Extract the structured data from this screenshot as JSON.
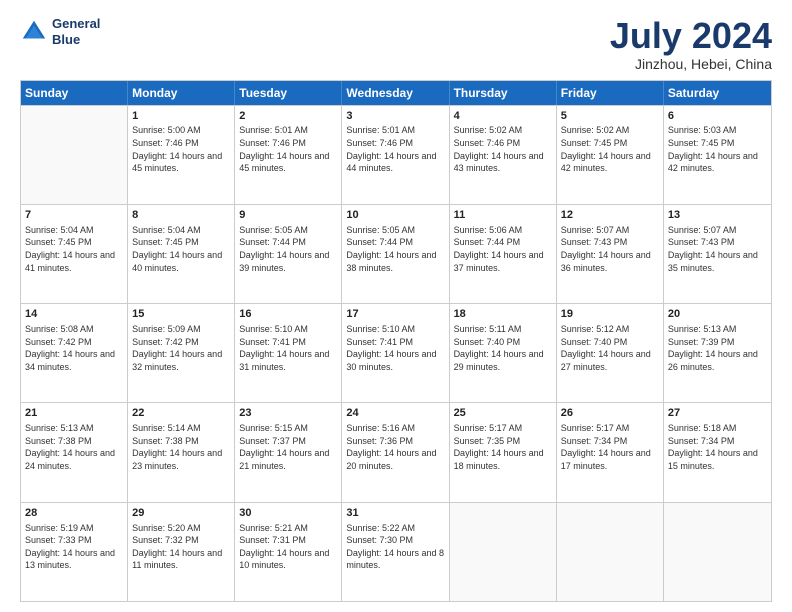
{
  "logo": {
    "line1": "General",
    "line2": "Blue"
  },
  "title": "July 2024",
  "subtitle": "Jinzhou, Hebei, China",
  "header_days": [
    "Sunday",
    "Monday",
    "Tuesday",
    "Wednesday",
    "Thursday",
    "Friday",
    "Saturday"
  ],
  "weeks": [
    [
      {
        "day": "",
        "sunrise": "",
        "sunset": "",
        "daylight": ""
      },
      {
        "day": "1",
        "sunrise": "Sunrise: 5:00 AM",
        "sunset": "Sunset: 7:46 PM",
        "daylight": "Daylight: 14 hours and 45 minutes."
      },
      {
        "day": "2",
        "sunrise": "Sunrise: 5:01 AM",
        "sunset": "Sunset: 7:46 PM",
        "daylight": "Daylight: 14 hours and 45 minutes."
      },
      {
        "day": "3",
        "sunrise": "Sunrise: 5:01 AM",
        "sunset": "Sunset: 7:46 PM",
        "daylight": "Daylight: 14 hours and 44 minutes."
      },
      {
        "day": "4",
        "sunrise": "Sunrise: 5:02 AM",
        "sunset": "Sunset: 7:46 PM",
        "daylight": "Daylight: 14 hours and 43 minutes."
      },
      {
        "day": "5",
        "sunrise": "Sunrise: 5:02 AM",
        "sunset": "Sunset: 7:45 PM",
        "daylight": "Daylight: 14 hours and 42 minutes."
      },
      {
        "day": "6",
        "sunrise": "Sunrise: 5:03 AM",
        "sunset": "Sunset: 7:45 PM",
        "daylight": "Daylight: 14 hours and 42 minutes."
      }
    ],
    [
      {
        "day": "7",
        "sunrise": "Sunrise: 5:04 AM",
        "sunset": "Sunset: 7:45 PM",
        "daylight": "Daylight: 14 hours and 41 minutes."
      },
      {
        "day": "8",
        "sunrise": "Sunrise: 5:04 AM",
        "sunset": "Sunset: 7:45 PM",
        "daylight": "Daylight: 14 hours and 40 minutes."
      },
      {
        "day": "9",
        "sunrise": "Sunrise: 5:05 AM",
        "sunset": "Sunset: 7:44 PM",
        "daylight": "Daylight: 14 hours and 39 minutes."
      },
      {
        "day": "10",
        "sunrise": "Sunrise: 5:05 AM",
        "sunset": "Sunset: 7:44 PM",
        "daylight": "Daylight: 14 hours and 38 minutes."
      },
      {
        "day": "11",
        "sunrise": "Sunrise: 5:06 AM",
        "sunset": "Sunset: 7:44 PM",
        "daylight": "Daylight: 14 hours and 37 minutes."
      },
      {
        "day": "12",
        "sunrise": "Sunrise: 5:07 AM",
        "sunset": "Sunset: 7:43 PM",
        "daylight": "Daylight: 14 hours and 36 minutes."
      },
      {
        "day": "13",
        "sunrise": "Sunrise: 5:07 AM",
        "sunset": "Sunset: 7:43 PM",
        "daylight": "Daylight: 14 hours and 35 minutes."
      }
    ],
    [
      {
        "day": "14",
        "sunrise": "Sunrise: 5:08 AM",
        "sunset": "Sunset: 7:42 PM",
        "daylight": "Daylight: 14 hours and 34 minutes."
      },
      {
        "day": "15",
        "sunrise": "Sunrise: 5:09 AM",
        "sunset": "Sunset: 7:42 PM",
        "daylight": "Daylight: 14 hours and 32 minutes."
      },
      {
        "day": "16",
        "sunrise": "Sunrise: 5:10 AM",
        "sunset": "Sunset: 7:41 PM",
        "daylight": "Daylight: 14 hours and 31 minutes."
      },
      {
        "day": "17",
        "sunrise": "Sunrise: 5:10 AM",
        "sunset": "Sunset: 7:41 PM",
        "daylight": "Daylight: 14 hours and 30 minutes."
      },
      {
        "day": "18",
        "sunrise": "Sunrise: 5:11 AM",
        "sunset": "Sunset: 7:40 PM",
        "daylight": "Daylight: 14 hours and 29 minutes."
      },
      {
        "day": "19",
        "sunrise": "Sunrise: 5:12 AM",
        "sunset": "Sunset: 7:40 PM",
        "daylight": "Daylight: 14 hours and 27 minutes."
      },
      {
        "day": "20",
        "sunrise": "Sunrise: 5:13 AM",
        "sunset": "Sunset: 7:39 PM",
        "daylight": "Daylight: 14 hours and 26 minutes."
      }
    ],
    [
      {
        "day": "21",
        "sunrise": "Sunrise: 5:13 AM",
        "sunset": "Sunset: 7:38 PM",
        "daylight": "Daylight: 14 hours and 24 minutes."
      },
      {
        "day": "22",
        "sunrise": "Sunrise: 5:14 AM",
        "sunset": "Sunset: 7:38 PM",
        "daylight": "Daylight: 14 hours and 23 minutes."
      },
      {
        "day": "23",
        "sunrise": "Sunrise: 5:15 AM",
        "sunset": "Sunset: 7:37 PM",
        "daylight": "Daylight: 14 hours and 21 minutes."
      },
      {
        "day": "24",
        "sunrise": "Sunrise: 5:16 AM",
        "sunset": "Sunset: 7:36 PM",
        "daylight": "Daylight: 14 hours and 20 minutes."
      },
      {
        "day": "25",
        "sunrise": "Sunrise: 5:17 AM",
        "sunset": "Sunset: 7:35 PM",
        "daylight": "Daylight: 14 hours and 18 minutes."
      },
      {
        "day": "26",
        "sunrise": "Sunrise: 5:17 AM",
        "sunset": "Sunset: 7:34 PM",
        "daylight": "Daylight: 14 hours and 17 minutes."
      },
      {
        "day": "27",
        "sunrise": "Sunrise: 5:18 AM",
        "sunset": "Sunset: 7:34 PM",
        "daylight": "Daylight: 14 hours and 15 minutes."
      }
    ],
    [
      {
        "day": "28",
        "sunrise": "Sunrise: 5:19 AM",
        "sunset": "Sunset: 7:33 PM",
        "daylight": "Daylight: 14 hours and 13 minutes."
      },
      {
        "day": "29",
        "sunrise": "Sunrise: 5:20 AM",
        "sunset": "Sunset: 7:32 PM",
        "daylight": "Daylight: 14 hours and 11 minutes."
      },
      {
        "day": "30",
        "sunrise": "Sunrise: 5:21 AM",
        "sunset": "Sunset: 7:31 PM",
        "daylight": "Daylight: 14 hours and 10 minutes."
      },
      {
        "day": "31",
        "sunrise": "Sunrise: 5:22 AM",
        "sunset": "Sunset: 7:30 PM",
        "daylight": "Daylight: 14 hours and 8 minutes."
      },
      {
        "day": "",
        "sunrise": "",
        "sunset": "",
        "daylight": ""
      },
      {
        "day": "",
        "sunrise": "",
        "sunset": "",
        "daylight": ""
      },
      {
        "day": "",
        "sunrise": "",
        "sunset": "",
        "daylight": ""
      }
    ]
  ]
}
